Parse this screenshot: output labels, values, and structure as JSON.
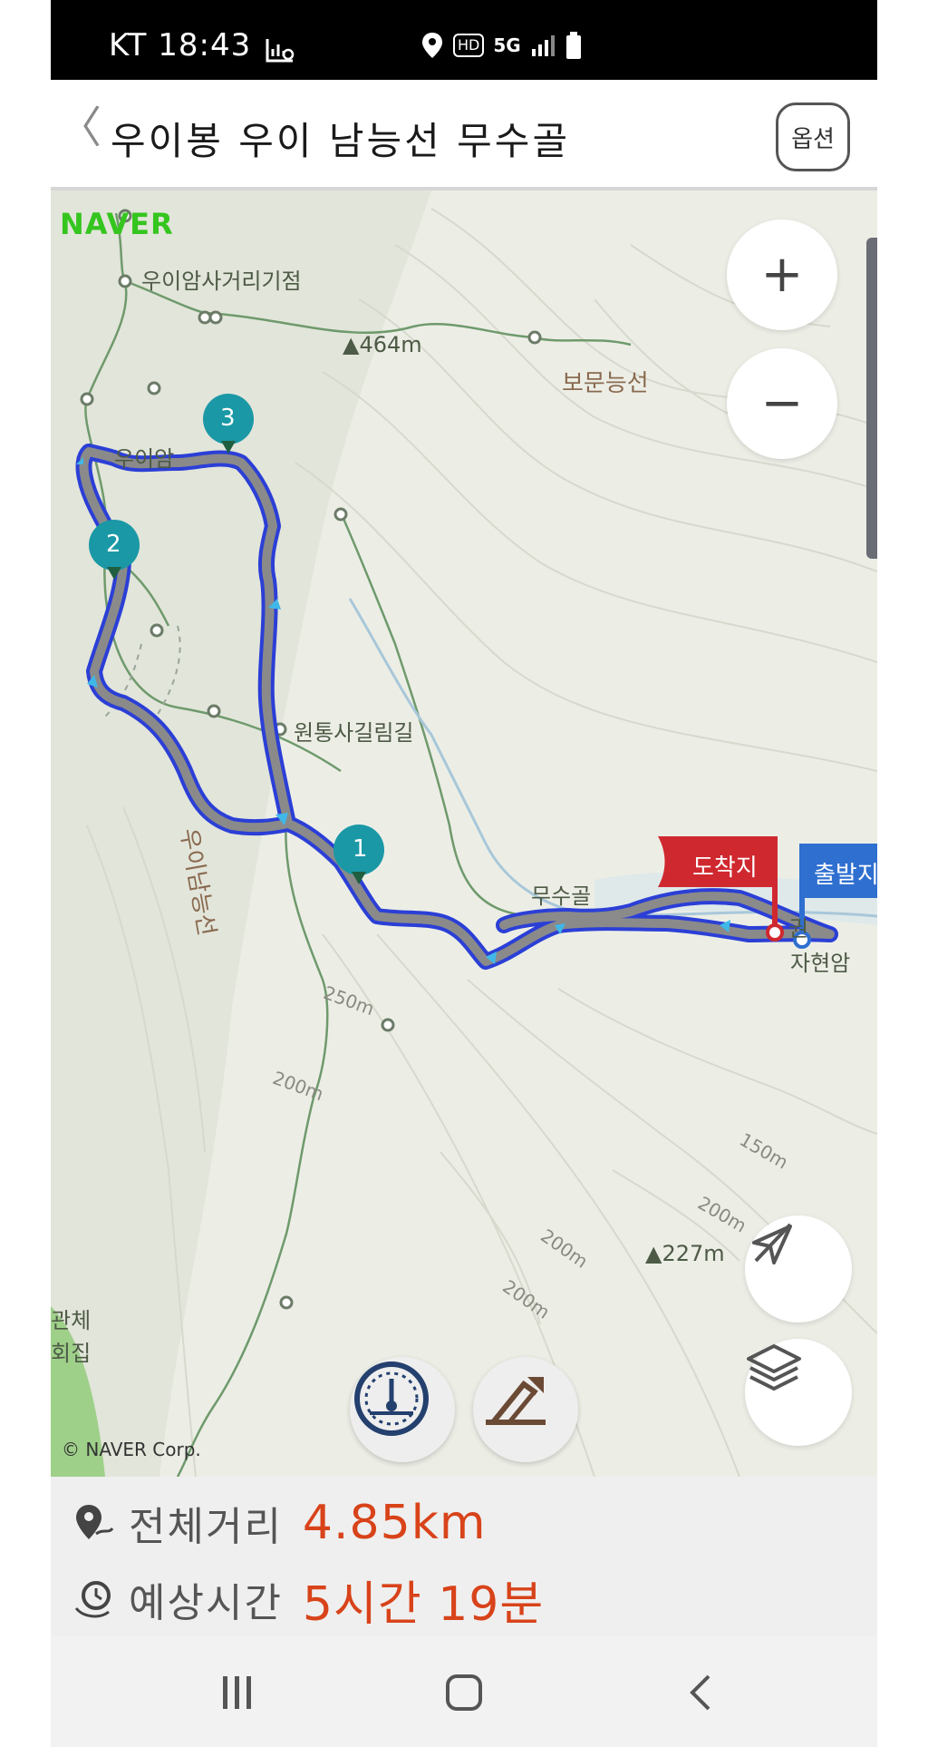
{
  "status_bar": {
    "carrier_time": "KT 18:43",
    "icons": [
      "analytics-icon",
      "location-icon",
      "hd-icon",
      "5g-icon",
      "signal-icon",
      "battery-icon"
    ],
    "hd_label": "HD",
    "net_label": "5G"
  },
  "header": {
    "back_label": "〈",
    "title": "우이봉 우이 남능선 무수골",
    "options_label": "옵션"
  },
  "map": {
    "brand": "NAVER",
    "copyright": "© NAVER Corp.",
    "labels": {
      "junction": "우이암사거리기점",
      "peak464": "▲464m",
      "bomun": "보문능선",
      "uiam": "우이암",
      "wontong": "원통사길림길",
      "uinam": "우이남능선",
      "musugol": "무수골",
      "jahyeonam": "자현암",
      "gwon": "권",
      "c250": "250m",
      "c200a": "200m",
      "c150": "150m",
      "c200b": "200m",
      "c200c": "200m",
      "c200d": "200m",
      "peak227": "▲227m",
      "hall1": "관체",
      "hall2": "회집"
    },
    "waypoints": [
      "1",
      "2",
      "3"
    ],
    "flags": {
      "finish": "도착지",
      "start": "출발지"
    },
    "zoom_in": "+",
    "zoom_out": "−"
  },
  "route_info": {
    "distance_label": "전체거리",
    "distance_value": "4.85km",
    "time_label": "예상시간",
    "time_value": "5시간 19분"
  },
  "colors": {
    "route_outline": "#2b3fd6",
    "route_fill": "#8a8a8a",
    "waypoint": "#1a98a6",
    "finish_flag": "#d0282f",
    "start_flag": "#2e6fd0",
    "value_text": "#d8431a",
    "naver_green": "#35c51f"
  }
}
